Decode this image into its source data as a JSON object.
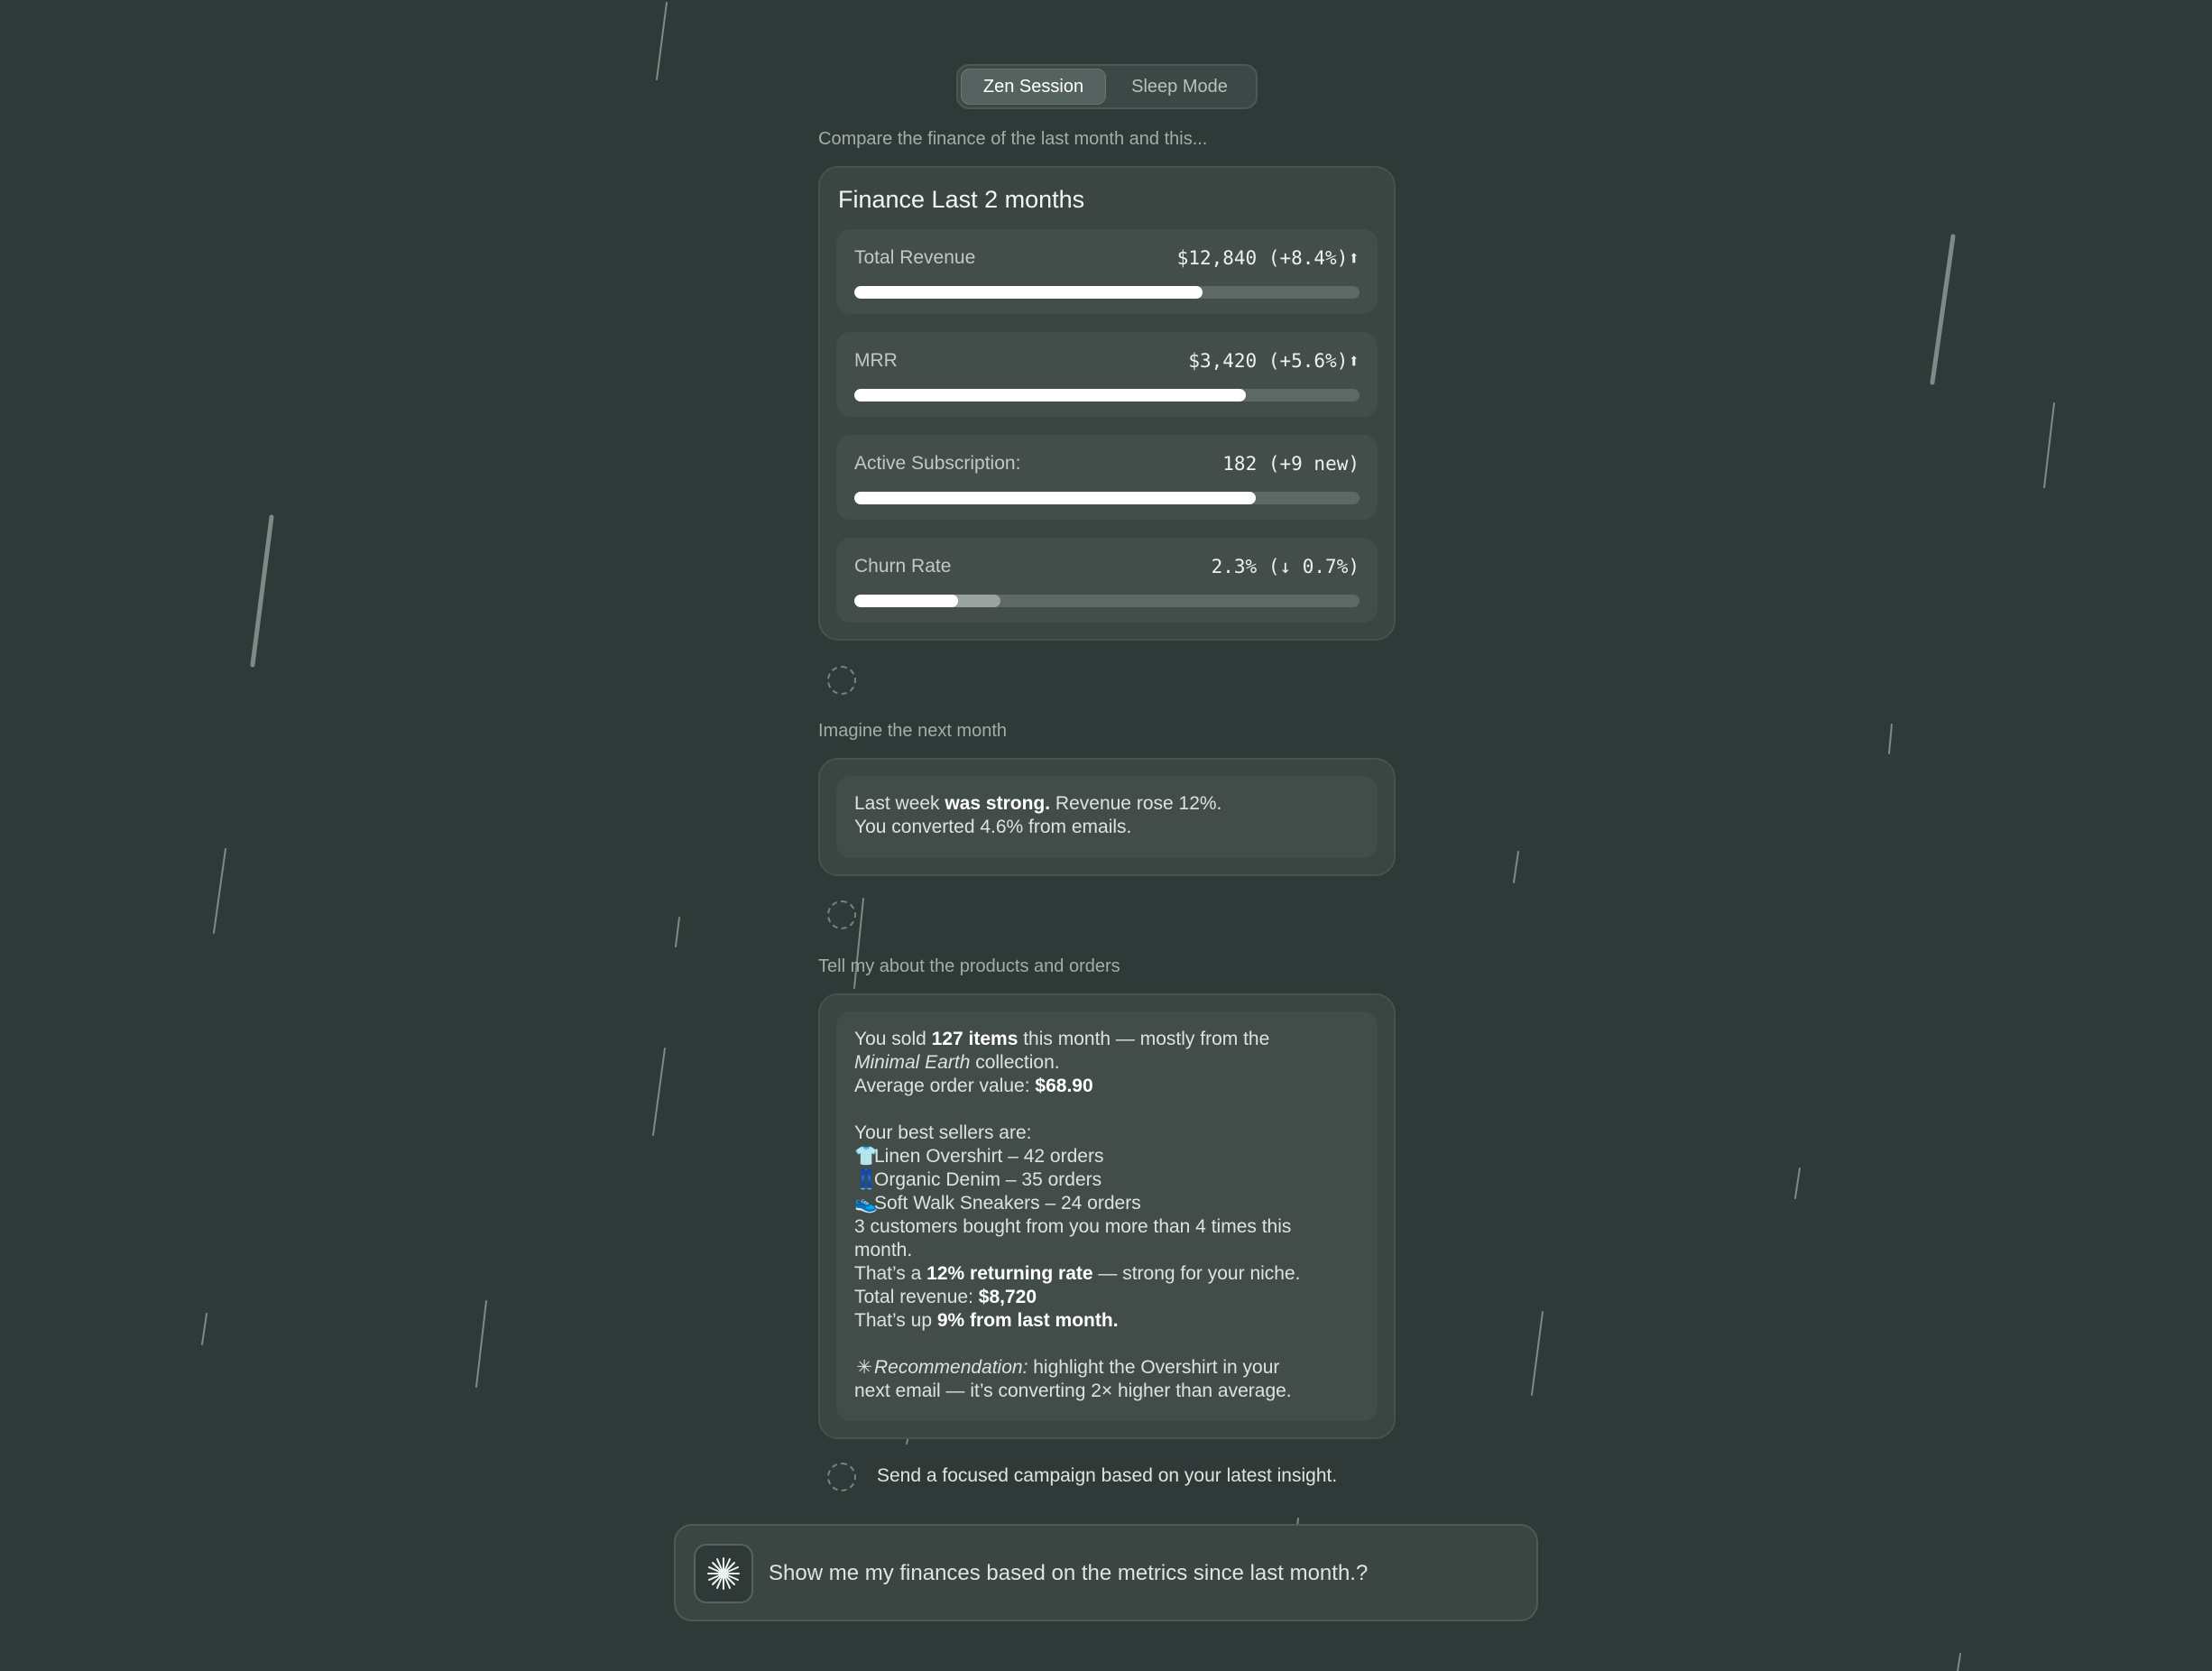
{
  "mode_toggle": {
    "active": "Zen Session",
    "inactive": "Sleep Mode"
  },
  "conversation": {
    "prompt_1": "Compare the finance of the last month and this...",
    "finance_card": {
      "title": "Finance Last 2 months",
      "metrics": [
        {
          "label": "Total Revenue",
          "value": "$12,840 (+8.4%)",
          "trend_icon": "up-arrow-icon",
          "previous_fraction": 0,
          "current_fraction": 0.69
        },
        {
          "label": "MRR",
          "value": "$3,420 (+5.6%)",
          "trend_icon": "up-arrow-icon",
          "previous_fraction": 0.665,
          "current_fraction": 0.775
        },
        {
          "label": "Active Subscription:",
          "value": "182 (+9 new)",
          "previous_fraction": 0.515,
          "current_fraction": 0.795
        },
        {
          "label": "Churn Rate",
          "value": "2.3% (↓ 0.7%)",
          "previous_fraction": 0.29,
          "current_fraction": 0.205
        }
      ]
    },
    "prompt_2": "Imagine the next month",
    "summary_card": {
      "line1_a": "Last week ",
      "line1_b": "was strong.",
      "line1_c": " Revenue rose 12%.",
      "line2": "You converted 4.6% from emails."
    },
    "prompt_3": "Tell my about the products and orders",
    "products_card": {
      "p1_a": "You sold ",
      "p1_b": "127 items",
      "p1_c": " this month — mostly from the",
      "p2_a": "Minimal Earth",
      "p2_b": " collection.",
      "p3_a": "Average order value: ",
      "p3_b": "$68.90",
      "best_sellers_heading": "Your best sellers are:",
      "sellers": [
        {
          "icon": "shirt-icon",
          "text": "Linen Overshirt – 42 orders"
        },
        {
          "icon": "jeans-icon",
          "text": "Organic Denim – 35 orders"
        },
        {
          "icon": "sneaker-icon",
          "text": "Soft Walk Sneakers – 24 orders"
        }
      ],
      "repeat_1": "3 customers bought from you more than 4 times this",
      "repeat_2": "month.",
      "rate_a": "That’s a ",
      "rate_b": "12% returning rate",
      "rate_c": " — strong for your niche.",
      "total_a": "Total revenue: ",
      "total_b": "$8,720",
      "up_a": "That’s up ",
      "up_b": "9% from last month.",
      "rec_icon": "sparkle-icon",
      "rec_label": "Recommendation:",
      "rec_text_1": " highlight the Overshirt in your",
      "rec_text_2": "next email — it’s converting 2× higher than average."
    },
    "pending_action": "Send a focused campaign based on your latest insight."
  },
  "input": {
    "value": "Show me my finances based on the metrics since last month.?",
    "button_icon": "sparkle-burst-icon"
  },
  "colors": {
    "background": "#2f3a38",
    "card": "#3b4643",
    "bar_current": "#ffffff",
    "bar_previous": "#9ba39f"
  }
}
